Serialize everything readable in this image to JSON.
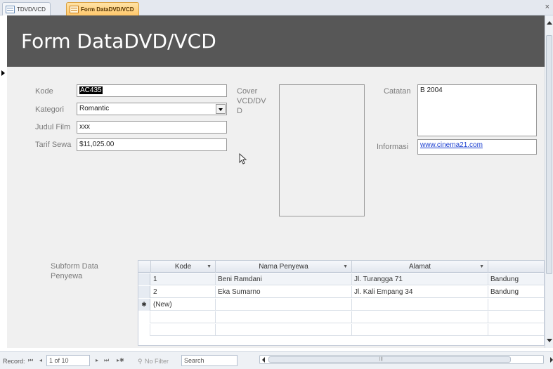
{
  "tabs": [
    {
      "label": "TDVD/VCD",
      "active": false
    },
    {
      "label": "Form DataDVD/VCD",
      "active": true
    }
  ],
  "close_label": "×",
  "form": {
    "title": "Form DataDVD/VCD",
    "fields": {
      "kode": {
        "label": "Kode",
        "value": "AC435"
      },
      "kategori": {
        "label": "Kategori",
        "value": "Romantic"
      },
      "judul": {
        "label": "Judul Film",
        "value": "xxx"
      },
      "tarif": {
        "label": "Tarif Sewa",
        "value": "$11,025.00"
      },
      "cover": {
        "label_1": "Cover",
        "label_2": "VCD/DV",
        "label_3": "D"
      },
      "catatan": {
        "label": "Catatan",
        "value": "B 2004"
      },
      "informasi": {
        "label": "Informasi",
        "value": "www.cinema21.com"
      }
    },
    "subform": {
      "label_1": "Subform Data",
      "label_2": "Penyewa",
      "columns": [
        "Kode",
        "Nama Penyewa",
        "Alamat",
        ""
      ],
      "rows": [
        [
          "1",
          "Beni Ramdani",
          "Jl. Turangga 71",
          "Bandung"
        ],
        [
          "2",
          "Eka Sumarno",
          "Jl. Kali Empang 34",
          "Bandung"
        ]
      ],
      "new_row_label": "(New)",
      "new_row_marker": "✱"
    }
  },
  "status": {
    "record_label": "Record:",
    "record_position": "1 of 10",
    "filter_label": "No Filter",
    "search_label": "Search",
    "nav_first": "⏮",
    "nav_prev": "◂",
    "nav_next": "▸",
    "nav_last": "⏭",
    "nav_new": "▸✱"
  },
  "colors": {
    "header_bg": "#575757",
    "active_tab": "#ffc86b",
    "link": "#1a3ed0"
  }
}
